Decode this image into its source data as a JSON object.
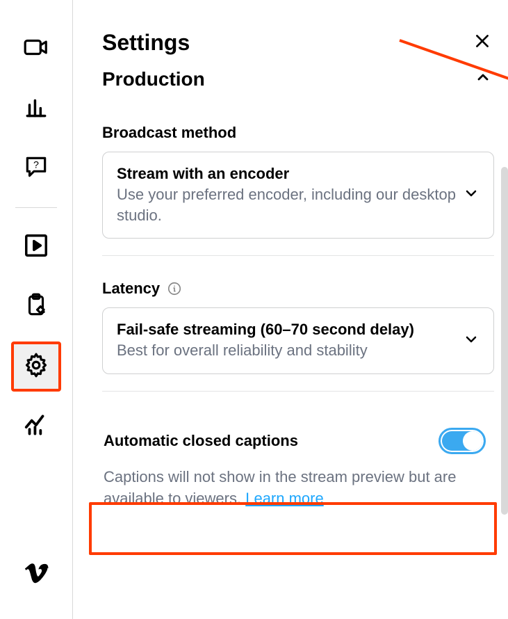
{
  "header": {
    "title": "Settings"
  },
  "section": {
    "title": "Production"
  },
  "broadcast": {
    "label": "Broadcast method",
    "option_title": "Stream with an encoder",
    "option_desc": "Use your preferred encoder, including our desktop studio."
  },
  "latency": {
    "label": "Latency",
    "option_title": "Fail-safe streaming (60–70 second delay)",
    "option_desc": "Best for overall reliability and stability"
  },
  "captions": {
    "label": "Automatic closed captions",
    "desc_prefix": "Captions will not show in the stream preview but are available to viewers. ",
    "learn_more": "Learn more",
    "enabled": true
  },
  "sidebar": {
    "items": [
      {
        "name": "camera"
      },
      {
        "name": "analytics-bars"
      },
      {
        "name": "chat-question"
      },
      {
        "name": "play-square"
      },
      {
        "name": "clipboard-edit"
      },
      {
        "name": "settings"
      },
      {
        "name": "analytics-trend"
      },
      {
        "name": "vimeo"
      }
    ]
  },
  "annotations": {
    "arrow_color": "#ff3b00",
    "highlight_color": "#ff3b00"
  }
}
